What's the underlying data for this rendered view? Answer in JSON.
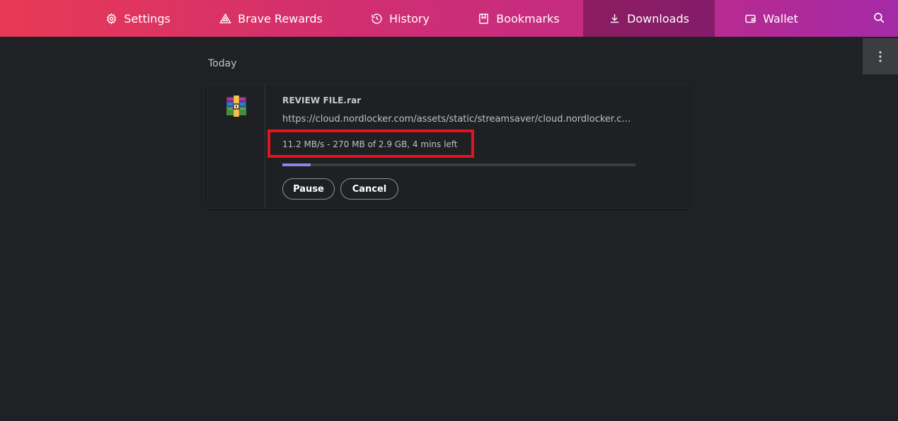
{
  "nav": {
    "tabs": [
      {
        "label": "Settings",
        "icon": "gear-icon",
        "active": false
      },
      {
        "label": "Brave Rewards",
        "icon": "triangle-icon",
        "active": false
      },
      {
        "label": "History",
        "icon": "history-icon",
        "active": false
      },
      {
        "label": "Bookmarks",
        "icon": "bookmark-icon",
        "active": false
      },
      {
        "label": "Downloads",
        "icon": "download-icon",
        "active": true
      },
      {
        "label": "Wallet",
        "icon": "wallet-icon",
        "active": false
      }
    ],
    "search_icon": "search-icon"
  },
  "menu": {
    "icon": "more-vertical-icon"
  },
  "downloads": {
    "section_header": "Today",
    "item": {
      "file_icon": "winrar-archive-icon",
      "filename": "REVIEW FILE.rar",
      "url": "https://cloud.nordlocker.com/assets/static/streamsaver/cloud.nordlocker.com/download",
      "status": "11.2 MB/s - 270 MB of 2.9 GB, 4 mins left",
      "progress_fraction": 0.08,
      "pause_label": "Pause",
      "cancel_label": "Cancel"
    }
  },
  "colors": {
    "accent_progress": "#8a86e9",
    "highlight_box": "#e4131d",
    "background": "#202124"
  }
}
